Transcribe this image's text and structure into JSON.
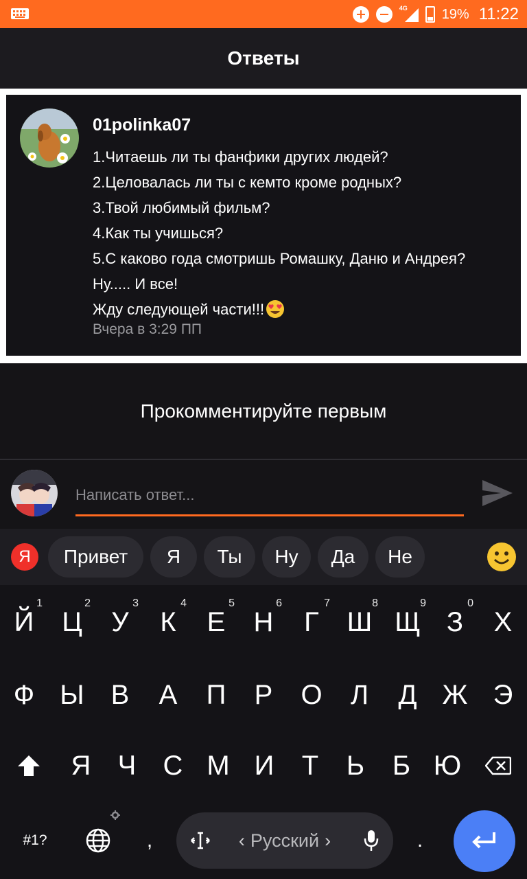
{
  "status_bar": {
    "battery": "19%",
    "time": "11:22",
    "network": "4G"
  },
  "app_bar": {
    "title": "Ответы"
  },
  "comment": {
    "username": "01polinka07",
    "lines": [
      "1.Читаешь ли ты фанфики других людей?",
      "2.Целовалась ли ты с кемто кроме родных?",
      "3.Твой любимый фильм?",
      "4.Как ты учишься?",
      "5.С каково года смотришь Ромашку, Даню и Андрея?",
      "Ну..... И все!",
      "Жду следующей части!!!"
    ],
    "timestamp": "Вчера в 3:29 ПП"
  },
  "empty_state": {
    "text": "Прокомментируйте первым"
  },
  "composer": {
    "placeholder": "Написать ответ..."
  },
  "keyboard": {
    "suggestion_logo": "Я",
    "suggestions": [
      "Привет",
      "Я",
      "Ты",
      "Ну",
      "Да",
      "Не"
    ],
    "row1": [
      {
        "k": "Й",
        "n": "1"
      },
      {
        "k": "Ц",
        "n": "2"
      },
      {
        "k": "У",
        "n": "3"
      },
      {
        "k": "К",
        "n": "4"
      },
      {
        "k": "Е",
        "n": "5"
      },
      {
        "k": "Н",
        "n": "6"
      },
      {
        "k": "Г",
        "n": "7"
      },
      {
        "k": "Ш",
        "n": "8"
      },
      {
        "k": "Щ",
        "n": "9"
      },
      {
        "k": "З",
        "n": "0"
      },
      {
        "k": "Х",
        "n": ""
      }
    ],
    "row2": [
      "Ф",
      "Ы",
      "В",
      "А",
      "П",
      "Р",
      "О",
      "Л",
      "Д",
      "Ж",
      "Э"
    ],
    "row3": [
      "Я",
      "Ч",
      "С",
      "М",
      "И",
      "Т",
      "Ь",
      "Б",
      "Ю"
    ],
    "symbols_label": "#1?",
    "comma": ",",
    "period": ".",
    "space_label": "Русский"
  },
  "colors": {
    "accent": "#ff6a1f",
    "background": "#151417",
    "enter_key": "#4b7ff6"
  }
}
